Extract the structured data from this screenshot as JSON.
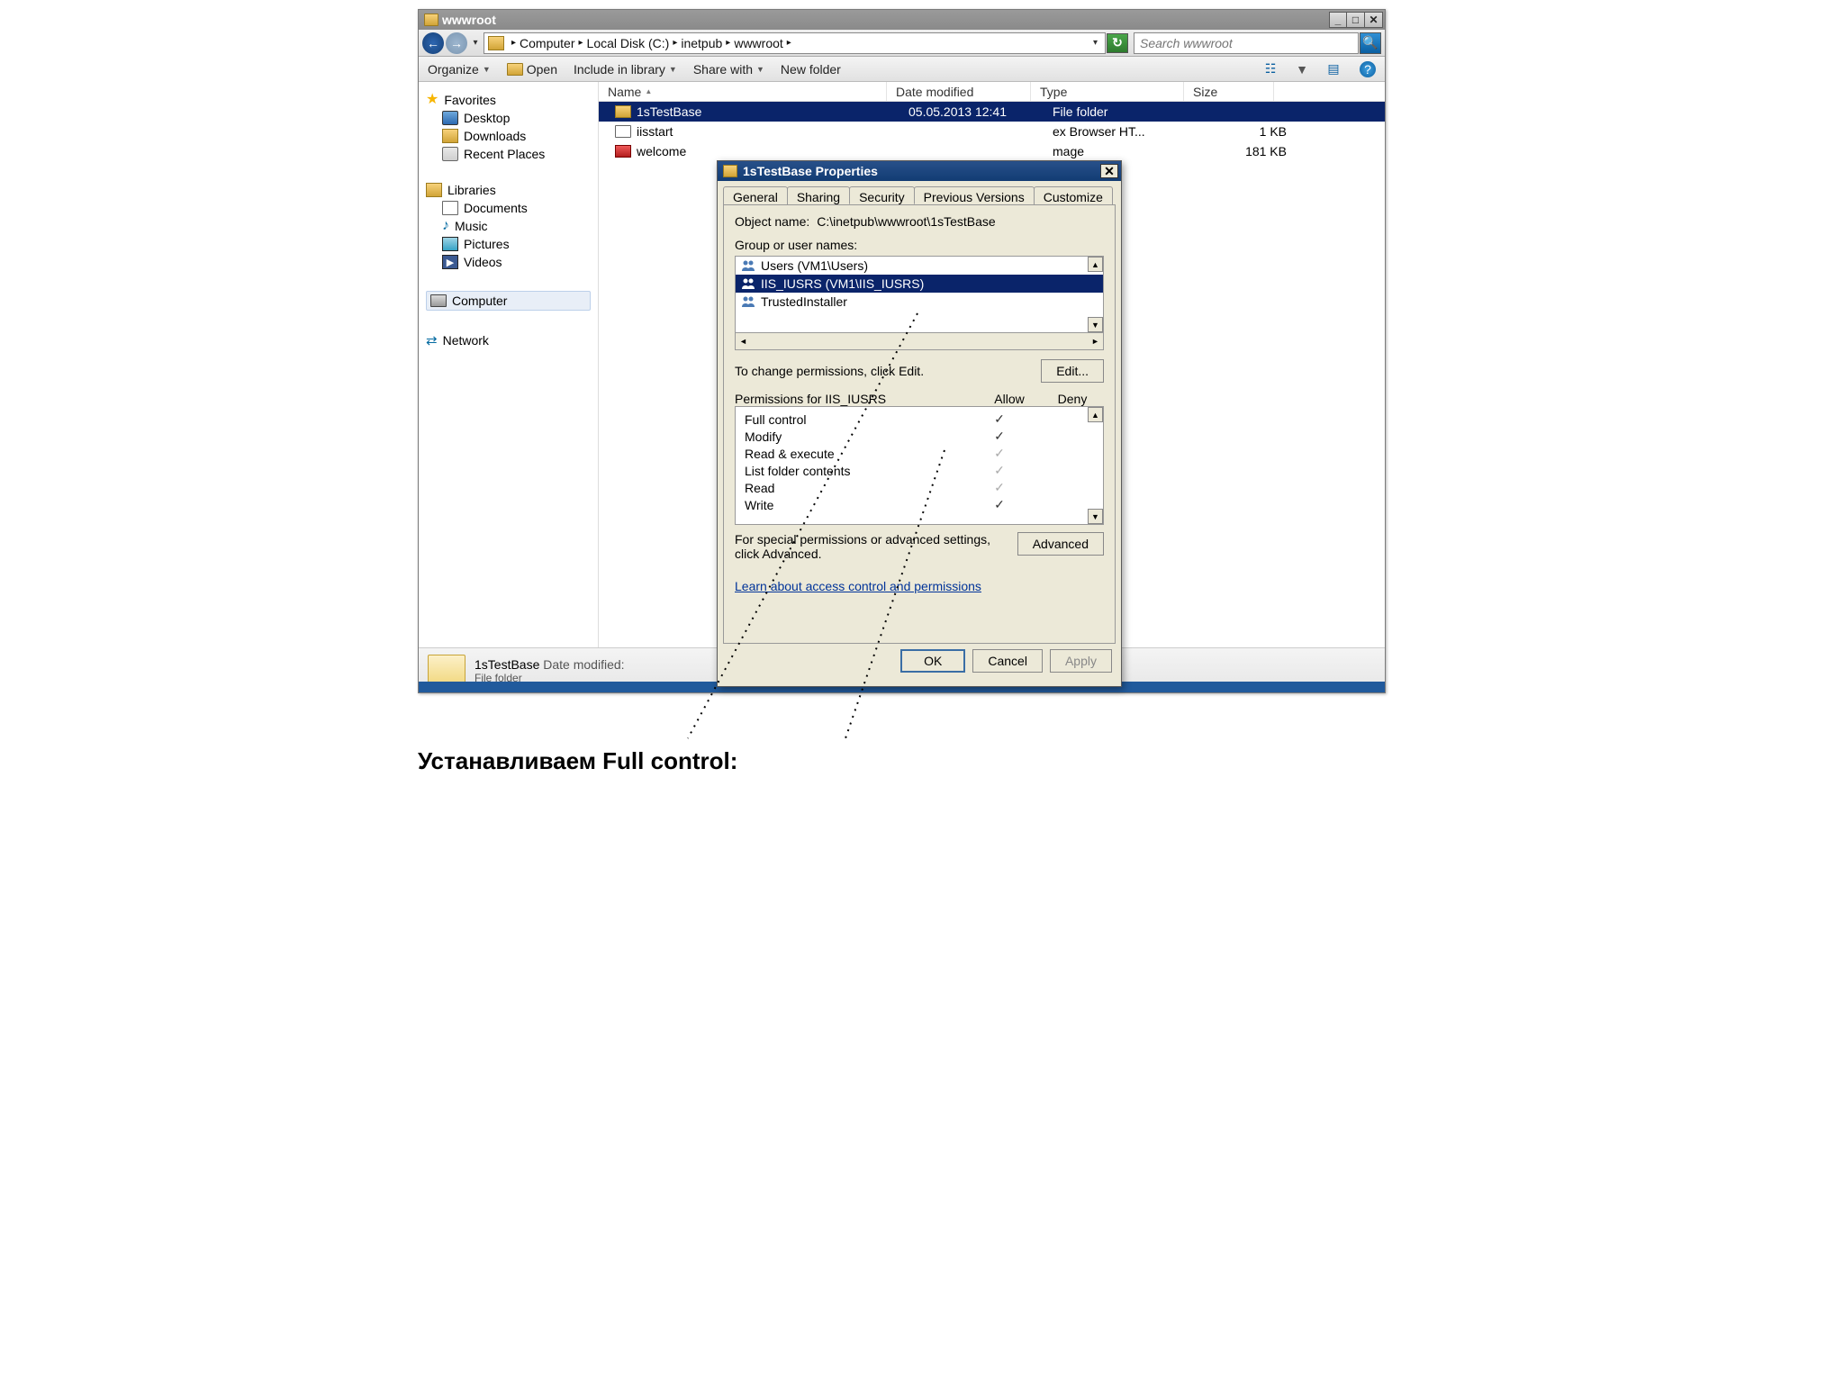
{
  "window": {
    "title": "wwwroot",
    "buttons": {
      "min": "_",
      "max": "□",
      "close": "✕"
    }
  },
  "addressbar": {
    "chevL": "←",
    "chevR": "→",
    "chevD": "▾",
    "crumbs": [
      "Computer",
      "Local Disk (C:)",
      "inetpub",
      "wwwroot"
    ],
    "sep": "▸",
    "refresh": "↻",
    "search_placeholder": "Search wwwroot",
    "search_icon": "🔍"
  },
  "toolbar": {
    "organize": "Organize",
    "open": "Open",
    "include": "Include in library",
    "share": "Share with",
    "newfolder": "New folder",
    "dd": "▼",
    "view_icon": "☷",
    "preview_icon": "▤",
    "help_icon": "?"
  },
  "nav": {
    "favorites": "Favorites",
    "desktop": "Desktop",
    "downloads": "Downloads",
    "recent": "Recent Places",
    "libraries": "Libraries",
    "documents": "Documents",
    "music": "Music",
    "pictures": "Pictures",
    "videos": "Videos",
    "computer": "Computer",
    "network": "Network"
  },
  "columns": {
    "name": "Name",
    "date": "Date modified",
    "type": "Type",
    "size": "Size",
    "sortarr": "▲"
  },
  "files": [
    {
      "name": "1sTestBase",
      "date": "05.05.2013 12:41",
      "type": "File folder",
      "size": "",
      "icon": "folder",
      "selected": true
    },
    {
      "name": "iisstart",
      "date": "",
      "type": "ex Browser HT...",
      "size": "1 KB",
      "icon": "html",
      "selected": false
    },
    {
      "name": "welcome",
      "date": "",
      "type": "mage",
      "size": "181 KB",
      "icon": "png",
      "selected": false
    }
  ],
  "status": {
    "name": "1sTestBase",
    "mod_label": "Date modified:",
    "type": "File folder"
  },
  "dialog": {
    "title": "1sTestBase Properties",
    "close": "✕",
    "tabs": [
      "General",
      "Sharing",
      "Security",
      "Previous Versions",
      "Customize"
    ],
    "active_tab": 2,
    "object_label": "Object name:",
    "object_value": "C:\\inetpub\\wwwroot\\1sTestBase",
    "groups_label": "Group or user names:",
    "groups": [
      {
        "name": "Users (VM1\\Users)",
        "sel": false
      },
      {
        "name": "IIS_IUSRS (VM1\\IIS_IUSRS)",
        "sel": true
      },
      {
        "name": "TrustedInstaller",
        "sel": false
      }
    ],
    "change_hint": "To change permissions, click Edit.",
    "edit": "Edit...",
    "perm_label": "Permissions for IIS_IUSRS",
    "allow": "Allow",
    "deny": "Deny",
    "perms": [
      {
        "name": "Full control",
        "allow": "✓",
        "strong": true
      },
      {
        "name": "Modify",
        "allow": "✓",
        "strong": true
      },
      {
        "name": "Read & execute",
        "allow": "✓",
        "strong": false
      },
      {
        "name": "List folder contents",
        "allow": "✓",
        "strong": false
      },
      {
        "name": "Read",
        "allow": "✓",
        "strong": false
      },
      {
        "name": "Write",
        "allow": "✓",
        "strong": true
      }
    ],
    "adv_hint": "For special permissions or advanced settings, click Advanced.",
    "advanced": "Advanced",
    "help": "Learn about access control and permissions",
    "ok": "OK",
    "cancel": "Cancel",
    "apply": "Apply"
  },
  "caption": "Устанавливаем Full control:"
}
